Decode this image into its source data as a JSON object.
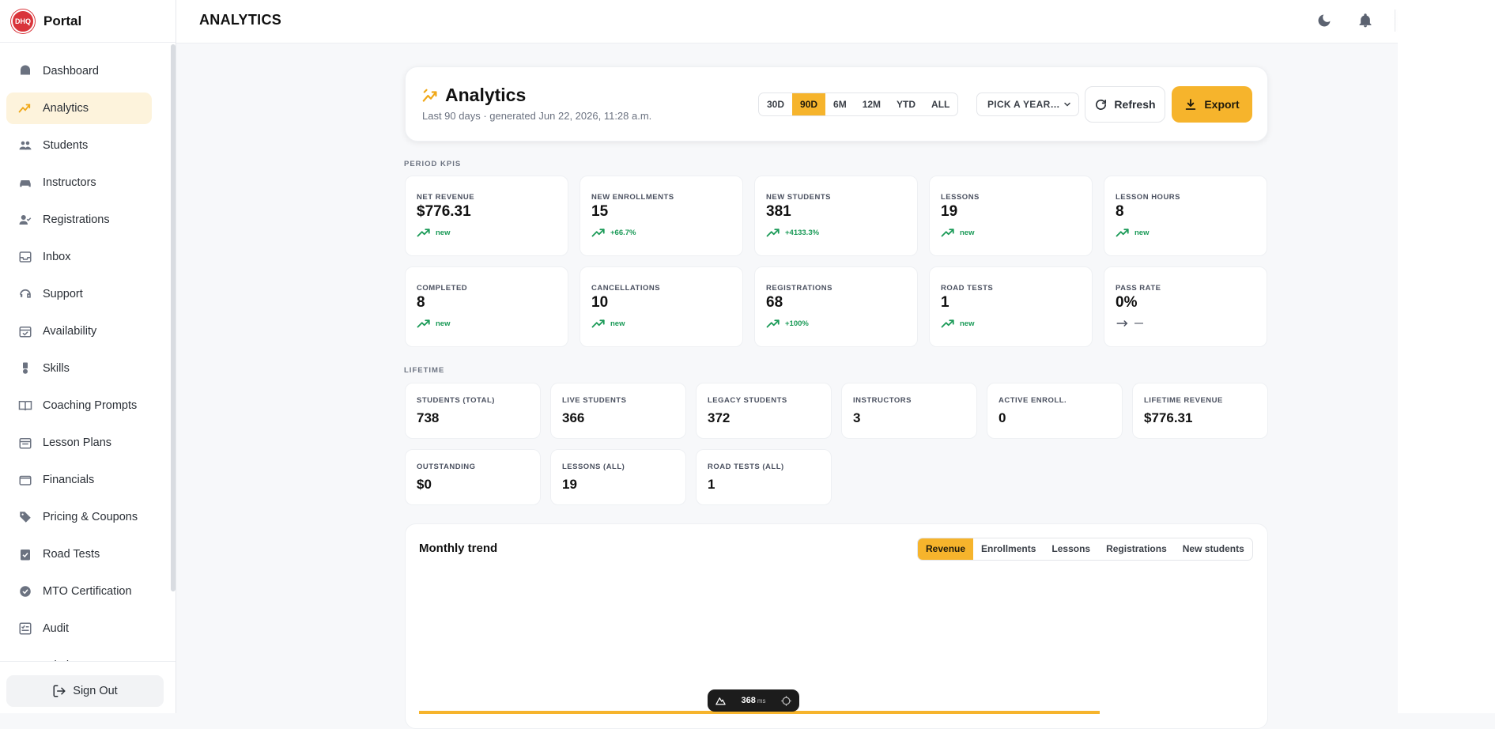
{
  "brand": {
    "logo_text": "DHQ",
    "name": "Portal"
  },
  "sidebar": {
    "items": [
      {
        "label": "Dashboard",
        "icon": "dashboard-icon",
        "active": false
      },
      {
        "label": "Analytics",
        "icon": "analytics-icon",
        "active": true
      },
      {
        "label": "Students",
        "icon": "students-icon",
        "active": false
      },
      {
        "label": "Instructors",
        "icon": "car-icon",
        "active": false
      },
      {
        "label": "Registrations",
        "icon": "user-check-icon",
        "active": false
      },
      {
        "label": "Inbox",
        "icon": "inbox-icon",
        "active": false
      },
      {
        "label": "Support",
        "icon": "support-icon",
        "active": false
      },
      {
        "label": "Availability",
        "icon": "calendar-check-icon",
        "active": false
      },
      {
        "label": "Skills",
        "icon": "medal-icon",
        "active": false
      },
      {
        "label": "Coaching Prompts",
        "icon": "book-open-icon",
        "active": false
      },
      {
        "label": "Lesson Plans",
        "icon": "calendar-icon",
        "active": false
      },
      {
        "label": "Financials",
        "icon": "wallet-icon",
        "active": false
      },
      {
        "label": "Pricing & Coupons",
        "icon": "tag-icon",
        "active": false
      },
      {
        "label": "Road Tests",
        "icon": "clipboard-check-icon",
        "active": false
      },
      {
        "label": "MTO Certification",
        "icon": "badge-check-icon",
        "active": false
      },
      {
        "label": "Audit",
        "icon": "checklist-icon",
        "active": false
      },
      {
        "label": "Admin Documents",
        "icon": "folder-icon",
        "active": false
      }
    ],
    "sign_out": "Sign Out"
  },
  "topbar": {
    "title": "ANALYTICS"
  },
  "header": {
    "title": "Analytics",
    "subtitle": "Last 90 days · generated Jun 22, 2026, 11:28 a.m.",
    "ranges": [
      "30D",
      "90D",
      "6M",
      "12M",
      "YTD",
      "ALL"
    ],
    "active_range": "90D",
    "year_select": "PICK A YEAR…",
    "refresh_label": "Refresh",
    "export_label": "Export"
  },
  "period_kpis": {
    "label": "PERIOD KPIS",
    "cards": [
      {
        "label": "NET REVENUE",
        "value": "$776.31",
        "delta": "new",
        "trend": "up"
      },
      {
        "label": "NEW ENROLLMENTS",
        "value": "15",
        "delta": "+66.7%",
        "trend": "up"
      },
      {
        "label": "NEW STUDENTS",
        "value": "381",
        "delta": "+4133.3%",
        "trend": "up"
      },
      {
        "label": "LESSONS",
        "value": "19",
        "delta": "new",
        "trend": "up"
      },
      {
        "label": "LESSON HOURS",
        "value": "8",
        "delta": "new",
        "trend": "up"
      },
      {
        "label": "COMPLETED",
        "value": "8",
        "delta": "new",
        "trend": "up"
      },
      {
        "label": "CANCELLATIONS",
        "value": "10",
        "delta": "new",
        "trend": "up"
      },
      {
        "label": "REGISTRATIONS",
        "value": "68",
        "delta": "+100%",
        "trend": "up"
      },
      {
        "label": "ROAD TESTS",
        "value": "1",
        "delta": "new",
        "trend": "up"
      },
      {
        "label": "PASS RATE",
        "value": "0%",
        "delta": "—",
        "trend": "flat"
      }
    ]
  },
  "lifetime": {
    "label": "LIFETIME",
    "cards": [
      {
        "label": "STUDENTS (TOTAL)",
        "value": "738"
      },
      {
        "label": "LIVE STUDENTS",
        "value": "366"
      },
      {
        "label": "LEGACY STUDENTS",
        "value": "372"
      },
      {
        "label": "INSTRUCTORS",
        "value": "3"
      },
      {
        "label": "ACTIVE ENROLL.",
        "value": "0"
      },
      {
        "label": "LIFETIME REVENUE",
        "value": "$776.31"
      },
      {
        "label": "OUTSTANDING",
        "value": "$0"
      },
      {
        "label": "LESSONS (ALL)",
        "value": "19"
      },
      {
        "label": "ROAD TESTS (ALL)",
        "value": "1"
      }
    ]
  },
  "trend": {
    "title": "Monthly trend",
    "tabs": [
      "Revenue",
      "Enrollments",
      "Lessons",
      "Registrations",
      "New students"
    ],
    "active_tab": "Revenue"
  },
  "dev_pill": {
    "value": "368",
    "unit": "ms"
  },
  "colors": {
    "accent": "#f6b42c",
    "positive": "#1a9a57",
    "brand": "#d9343a"
  }
}
